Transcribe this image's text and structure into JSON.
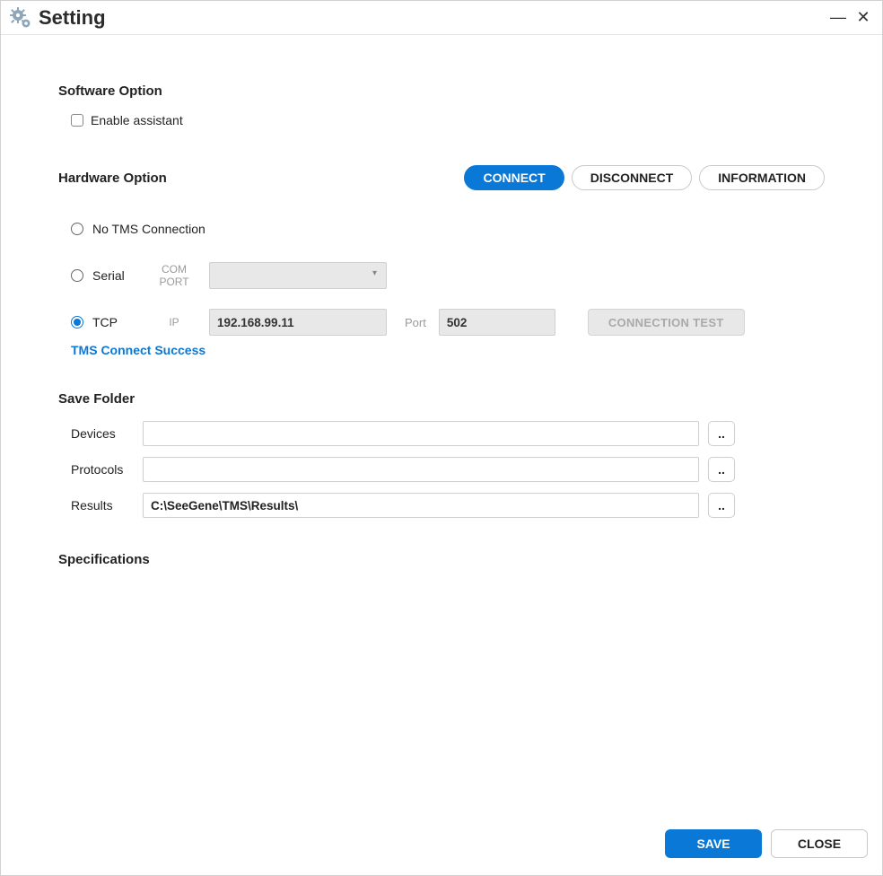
{
  "window": {
    "title": "Setting",
    "minimize_glyph": "—",
    "close_glyph": "✕"
  },
  "software": {
    "heading": "Software Option",
    "enable_assistant_label": "Enable assistant",
    "enable_assistant_checked": false
  },
  "hardware": {
    "heading": "Hardware Option",
    "buttons": {
      "connect": "CONNECT",
      "disconnect": "DISCONNECT",
      "information": "INFORMATION"
    },
    "options": {
      "none_label": "No TMS Connection",
      "serial_label": "Serial",
      "tcp_label": "TCP",
      "selected": "tcp"
    },
    "serial": {
      "com_port_label": "COM PORT",
      "com_port_value": ""
    },
    "tcp": {
      "ip_label": "IP",
      "ip_value": "192.168.99.11",
      "port_label": "Port",
      "port_value": "502",
      "connection_test_label": "CONNECTION TEST"
    },
    "status_message": "TMS Connect Success"
  },
  "save_folder": {
    "heading": "Save Folder",
    "rows": {
      "devices": {
        "label": "Devices",
        "value": ""
      },
      "protocols": {
        "label": "Protocols",
        "value": ""
      },
      "results": {
        "label": "Results",
        "value": "C:\\SeeGene\\TMS\\Results\\"
      }
    },
    "browse_glyph": ".."
  },
  "specifications": {
    "heading": "Specifications"
  },
  "footer": {
    "save": "SAVE",
    "close": "CLOSE"
  }
}
